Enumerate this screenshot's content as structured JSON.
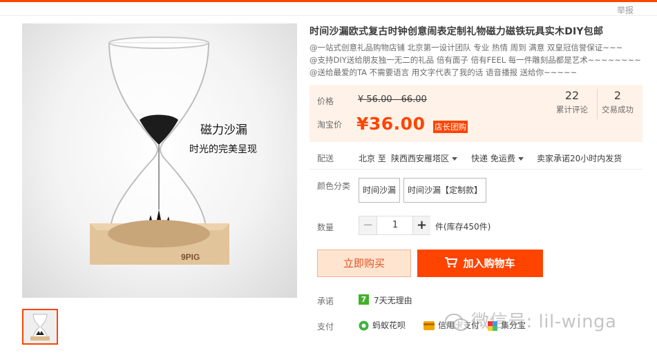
{
  "header": {
    "report_label": "举报"
  },
  "product": {
    "title": "时间沙漏欧式复古时钟创意闹表定制礼物磁力磁铁玩具实木DIY包邮",
    "subtitle_lines": [
      "@一站式创意礼品购物店铺 北京第一设计团队 专业 热情 周到 满意 双皇冠信誉保证~~~",
      "@支持DIY送给朋友独一无二的礼品 倍有面子 倍有FEEL 每一件雕刻品都是艺术~~~~~~~~",
      "@送给最爱的TA 不需要语言 用文字代表了我的话 语音播报 送给你~~~~~"
    ],
    "image_caption_line1": "磁力沙漏",
    "image_caption_line2": "时光的完美呈现",
    "image_brand": "9PIG"
  },
  "price": {
    "price_label": "价格",
    "original_price": "¥ 56.00 - 66.00",
    "taobao_label": "淘宝价",
    "promo_price": "¥36.00",
    "promo_badge": "店长团购"
  },
  "stats": {
    "reviews_count": "22",
    "reviews_label": "累计评论",
    "deals_count": "2",
    "deals_label": "交易成功"
  },
  "shipping": {
    "label": "配送",
    "from": "北京 至",
    "to": "陕西西安雁塔区",
    "method": "快递 免运费",
    "promise": "卖家承诺20小时内发货"
  },
  "sku": {
    "label": "颜色分类",
    "options": [
      "时间沙漏",
      "时间沙漏【定制款】"
    ]
  },
  "quantity": {
    "label": "数量",
    "value": "1",
    "stock": "件(库存450件)"
  },
  "actions": {
    "buy_now": "立即购买",
    "add_to_cart": "加入购物车"
  },
  "promise": {
    "label": "承诺",
    "icon_text": "7",
    "text": "7天无理由"
  },
  "payment": {
    "label": "支付",
    "items": [
      "蚂蚁花呗",
      "信用卡支付",
      "集分宝"
    ]
  },
  "watermark": "微信号: lil-winga",
  "colors": {
    "accent": "#ff4400",
    "price_bg": "#fff2e8",
    "promise_green": "#43b02a"
  }
}
